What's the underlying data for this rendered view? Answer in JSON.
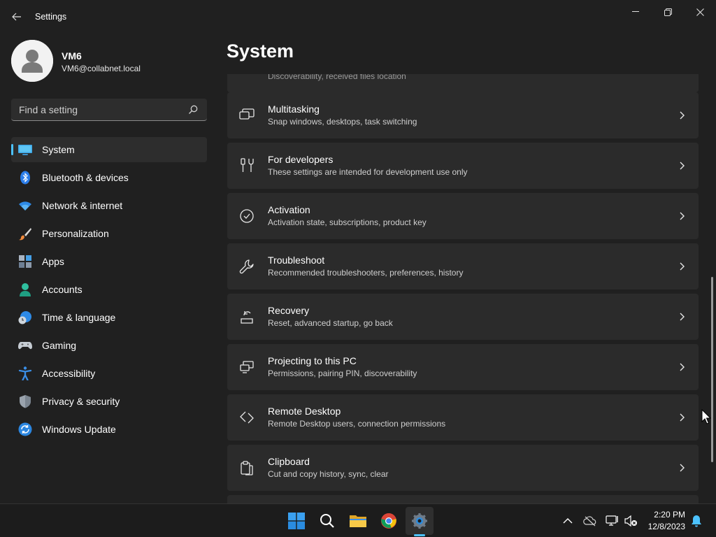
{
  "window": {
    "title": "Settings",
    "back_icon": "back-arrow-icon",
    "minimize_icon": "minimize-icon",
    "maximize_icon": "restore-icon",
    "close_icon": "close-icon"
  },
  "profile": {
    "name": "VM6",
    "email": "VM6@collabnet.local"
  },
  "search": {
    "placeholder": "Find a setting",
    "value": ""
  },
  "sidebar": {
    "items": [
      {
        "label": "System",
        "icon": "monitor-icon",
        "selected": true
      },
      {
        "label": "Bluetooth & devices",
        "icon": "bluetooth-icon"
      },
      {
        "label": "Network & internet",
        "icon": "wifi-icon"
      },
      {
        "label": "Personalization",
        "icon": "paintbrush-icon"
      },
      {
        "label": "Apps",
        "icon": "apps-icon"
      },
      {
        "label": "Accounts",
        "icon": "person-icon"
      },
      {
        "label": "Time & language",
        "icon": "globe-clock-icon"
      },
      {
        "label": "Gaming",
        "icon": "gamepad-icon"
      },
      {
        "label": "Accessibility",
        "icon": "accessibility-icon"
      },
      {
        "label": "Privacy & security",
        "icon": "shield-icon"
      },
      {
        "label": "Windows Update",
        "icon": "update-icon"
      }
    ]
  },
  "main": {
    "page_title": "System",
    "partial_item_subtitle": "Discoverability, received files location",
    "items": [
      {
        "title": "Multitasking",
        "subtitle": "Snap windows, desktops, task switching",
        "icon": "multitasking-icon"
      },
      {
        "title": "For developers",
        "subtitle": "These settings are intended for development use only",
        "icon": "developer-tools-icon"
      },
      {
        "title": "Activation",
        "subtitle": "Activation state, subscriptions, product key",
        "icon": "checkmark-circle-icon"
      },
      {
        "title": "Troubleshoot",
        "subtitle": "Recommended troubleshooters, preferences, history",
        "icon": "wrench-icon"
      },
      {
        "title": "Recovery",
        "subtitle": "Reset, advanced startup, go back",
        "icon": "recovery-icon"
      },
      {
        "title": "Projecting to this PC",
        "subtitle": "Permissions, pairing PIN, discoverability",
        "icon": "projecting-icon"
      },
      {
        "title": "Remote Desktop",
        "subtitle": "Remote Desktop users, connection permissions",
        "icon": "remote-desktop-icon"
      },
      {
        "title": "Clipboard",
        "subtitle": "Cut and copy history, sync, clear",
        "icon": "clipboard-icon"
      }
    ]
  },
  "taskbar": {
    "apps": [
      "start-icon",
      "search-icon",
      "file-explorer-icon",
      "chrome-icon",
      "settings-gear-icon"
    ],
    "tray": [
      "chevron-up-icon",
      "onedrive-offline-icon",
      "network-icon",
      "volume-muted-icon",
      "notification-bell-icon"
    ],
    "time": "2:20 PM",
    "date": "12/8/2023"
  },
  "colors": {
    "background": "#202020",
    "card": "#2b2b2b",
    "accent": "#4cc2ff",
    "taskbar": "#1c1c1c"
  }
}
